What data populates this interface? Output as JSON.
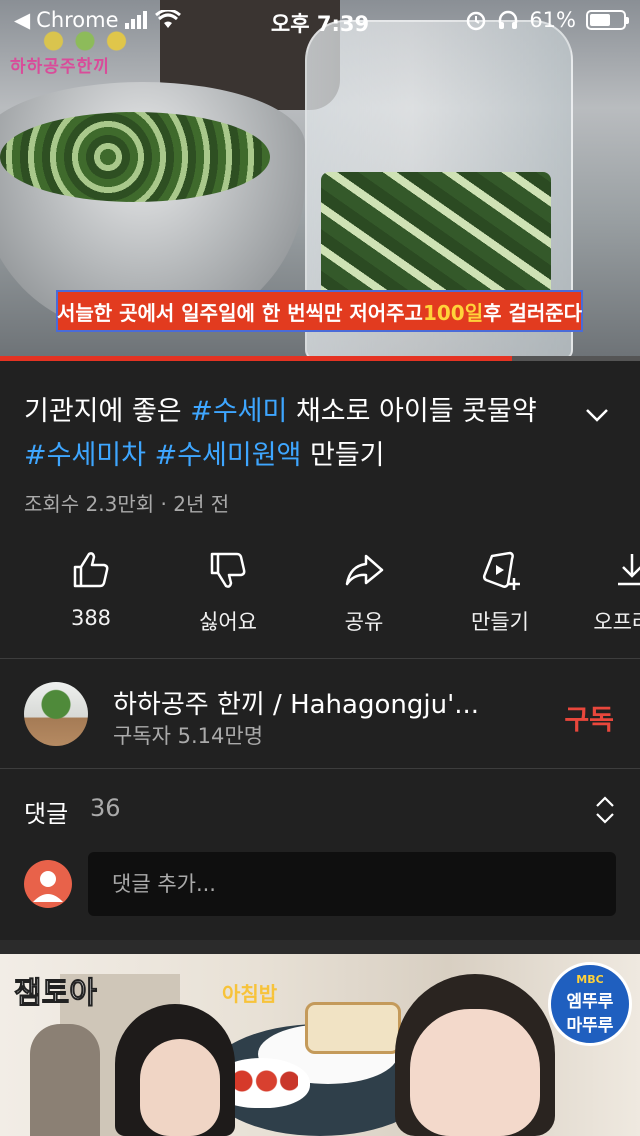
{
  "status_bar": {
    "carrier": "Chrome",
    "time": "오후 7:39",
    "battery_text": "61%",
    "battery_level": 0.61
  },
  "video": {
    "channel_logo_text": "하하공주한끼",
    "subtitle_pre": "서늘한 곳에서 일주일에 한 번씩만 저어주고 ",
    "subtitle_highlight": "100일",
    "subtitle_post": " 후 걸러준다",
    "progress": 0.8
  },
  "title": {
    "part1": "기관지에 좋은 ",
    "tag1": "#수세미",
    "part2": " 채소로 아이들 콧물약 ",
    "tag2": "#수세미차",
    "part3": " ",
    "tag3": "#수세미원액",
    "part4": " 만들기"
  },
  "meta": "조회수 2.3만회 · 2년 전",
  "actions": [
    {
      "label": "388",
      "icon": "like-icon"
    },
    {
      "label": "싫어요",
      "icon": "dislike-icon"
    },
    {
      "label": "공유",
      "icon": "share-icon"
    },
    {
      "label": "만들기",
      "icon": "remix-icon"
    },
    {
      "label": "오프라인",
      "icon": "download-icon"
    }
  ],
  "channel": {
    "name": "하하공주 한끼 / Hahagongju'...",
    "subscribers": "구독자 5.14만명",
    "subscribe_label": "구독"
  },
  "comments": {
    "label": "댓글",
    "count": "36",
    "placeholder": "댓글 추가..."
  },
  "next_video": {
    "label_left": "잼토아",
    "label_center": "아침밥",
    "badge_top": "MBC",
    "badge_line1": "엠뚜루",
    "badge_line2": "마뚜루"
  },
  "colors": {
    "background": "#212121",
    "accent_red": "#e53322",
    "hashtag_blue": "#3ea6ff",
    "subscribe_red": "#e9473c"
  }
}
